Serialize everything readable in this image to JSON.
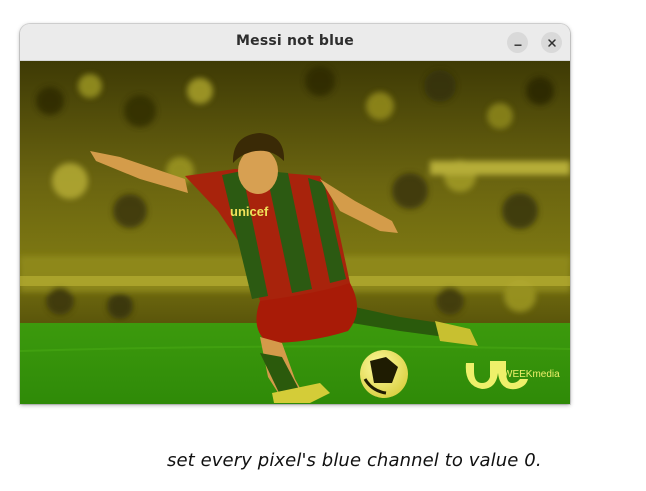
{
  "window": {
    "title": "Messi not blue"
  },
  "controls": {
    "minimize_icon": "minimize-icon",
    "close_icon": "close-icon"
  },
  "image": {
    "description_icon": "photo-yellow-tinted",
    "jersey_text": "unicef",
    "watermark": "WEEKmedia"
  },
  "caption": "set every pixel's blue channel to value 0.",
  "colors": {
    "titlebar": "#ebebeb",
    "pitch": "#3f9a10",
    "crowd": "#6b6a12",
    "jersey_red": "#b42a10",
    "jersey_green": "#2f5a12"
  }
}
